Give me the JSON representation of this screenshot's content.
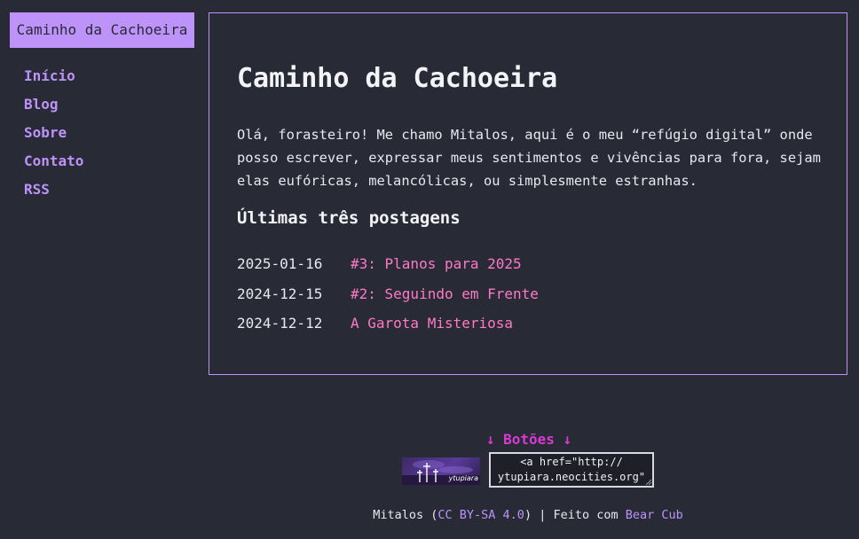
{
  "header": {
    "site_title": "Caminho da Cachoeira"
  },
  "nav": {
    "items": [
      {
        "label": "Início"
      },
      {
        "label": "Blog"
      },
      {
        "label": "Sobre"
      },
      {
        "label": "Contato"
      },
      {
        "label": "RSS"
      }
    ]
  },
  "main": {
    "title": "Caminho da Cachoeira",
    "intro": "Olá, forasteiro! Me chamo Mitalos, aqui é o meu “refúgio digital” onde posso escrever, expressar meus sentimentos e vivências para fora, sejam elas eufóricas, melancólicas, ou simplesmente estranhas.",
    "posts_heading": "Últimas três postagens",
    "posts": [
      {
        "date": "2025-01-16",
        "title": "#3: Planos para 2025"
      },
      {
        "date": "2024-12-15",
        "title": "#2: Seguindo em Frente"
      },
      {
        "date": "2024-12-12",
        "title": "A Garota Misteriosa"
      }
    ]
  },
  "footer": {
    "buttons_heading": "↓ Botões ↓",
    "badge_label": "ytupiara",
    "embed_code": "<a href=\"http://\nytupiara.neocities.org\"",
    "credits_prefix": "Mitalos (",
    "license": "CC BY-SA 4.0",
    "credits_middle": ") | Feito com ",
    "theme": "Bear Cub"
  },
  "colors": {
    "background": "#282a36",
    "accent_purple": "#bd93f9",
    "accent_pink": "#ff79c6",
    "buttons_heading": "#d63bd3"
  }
}
